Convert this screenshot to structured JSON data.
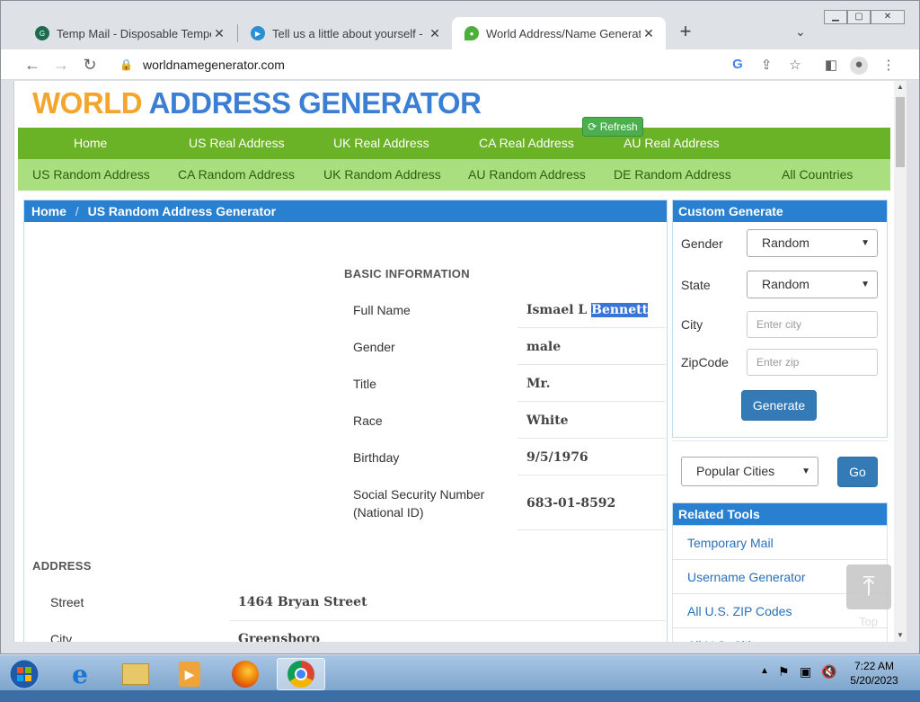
{
  "browser": {
    "tabs": [
      {
        "label": "Temp Mail - Disposable Tempora",
        "icon": "temp-mail-favicon",
        "icon_color": "#1f6b4f"
      },
      {
        "label": "Tell us a little about yourself - Blu",
        "icon": "bluesky-favicon",
        "icon_color": "#2a8fd0"
      },
      {
        "label": "World Address/Name Generator",
        "icon": "map-pin-favicon",
        "icon_color": "#4caf3c"
      }
    ],
    "close_glyph": "✕",
    "new_tab": "+",
    "url": "worldnamegenerator.com"
  },
  "site": {
    "logo_part1": "WORLD",
    "logo_part2": "ADDRESS GENERATOR",
    "nav_primary": [
      "Home",
      "US Real Address",
      "UK Real Address",
      "CA Real Address",
      "AU Real Address"
    ],
    "nav_secondary": [
      "US Random Address",
      "CA Random Address",
      "UK Random Address",
      "AU Random Address",
      "DE Random Address",
      "All Countries"
    ]
  },
  "breadcrumb": {
    "home": "Home",
    "separator": "/",
    "current": "US Random Address Generator"
  },
  "refresh_label": "Refresh",
  "basic_info": {
    "heading": "BASIC INFORMATION",
    "rows": [
      {
        "label": "Full Name",
        "value_plain": "Ismael L ",
        "value_selected": "Bennett"
      },
      {
        "label": "Gender",
        "value": "male"
      },
      {
        "label": "Title",
        "value": "Mr."
      },
      {
        "label": "Race",
        "value": "White"
      },
      {
        "label": "Birthday",
        "value": "9/5/1976"
      },
      {
        "label": "Social Security Number",
        "label2": "(National ID)",
        "value": "683-01-8592"
      }
    ]
  },
  "address": {
    "heading": "ADDRESS",
    "rows": [
      {
        "label": "Street",
        "value": "1464 Bryan Street"
      },
      {
        "label": "City",
        "value": "Greensboro"
      }
    ]
  },
  "custom_generate": {
    "heading": "Custom Generate",
    "gender_label": "Gender",
    "gender_value": "Random",
    "state_label": "State",
    "state_value": "Random",
    "city_label": "City",
    "city_placeholder": "Enter city",
    "zip_label": "ZipCode",
    "zip_placeholder": "Enter zip",
    "generate_label": "Generate",
    "cities_value": "Popular Cities",
    "go_label": "Go"
  },
  "related_tools": {
    "heading": "Related Tools",
    "links": [
      "Temporary Mail",
      "Username Generator",
      "All U.S. ZIP Codes",
      "All U.S. Cities"
    ]
  },
  "top_label": "Top",
  "taskbar": {
    "time": "7:22 AM",
    "date": "5/20/2023"
  },
  "colors": {
    "nav_primary_bg": "#6ab226",
    "nav_secondary_bg": "#a9df7e",
    "panel_header": "#2a80d0",
    "logo_orange": "#f4a52d",
    "logo_blue": "#3b7fd4"
  }
}
